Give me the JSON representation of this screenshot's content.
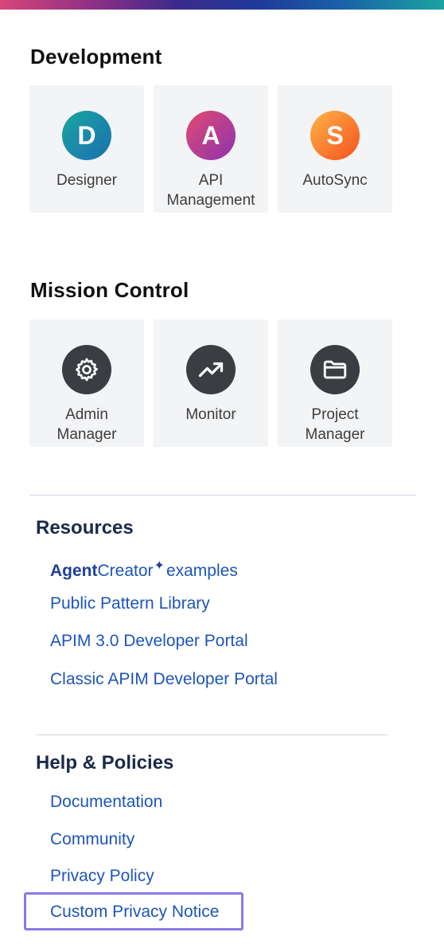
{
  "development": {
    "title": "Development",
    "tiles": [
      {
        "letter": "D",
        "label": "Designer"
      },
      {
        "letter": "A",
        "label": "API Management"
      },
      {
        "letter": "S",
        "label": "AutoSync"
      }
    ]
  },
  "mission_control": {
    "title": "Mission Control",
    "tiles": [
      {
        "icon": "gear-icon",
        "label": "Admin Manager"
      },
      {
        "icon": "trend-up-icon",
        "label": "Monitor"
      },
      {
        "icon": "folder-icon",
        "label": "Project Manager"
      }
    ]
  },
  "resources": {
    "title": "Resources",
    "links": [
      {
        "label_bold": "Agent",
        "label_light": "Creator",
        "label_rest": "examples"
      },
      {
        "label": "Public Pattern Library"
      },
      {
        "label": "APIM 3.0 Developer Portal"
      },
      {
        "label": "Classic APIM Developer Portal"
      }
    ]
  },
  "help": {
    "title": "Help & Policies",
    "links": [
      {
        "label": "Documentation"
      },
      {
        "label": "Community"
      },
      {
        "label": "Privacy Policy"
      },
      {
        "label": "Custom Privacy Notice"
      }
    ]
  },
  "colors": {
    "link": "#1e55b8",
    "focus_outline": "#8b78e6",
    "tile_bg": "#f3f4f6",
    "dark_icon_bg": "#3a3d42"
  }
}
